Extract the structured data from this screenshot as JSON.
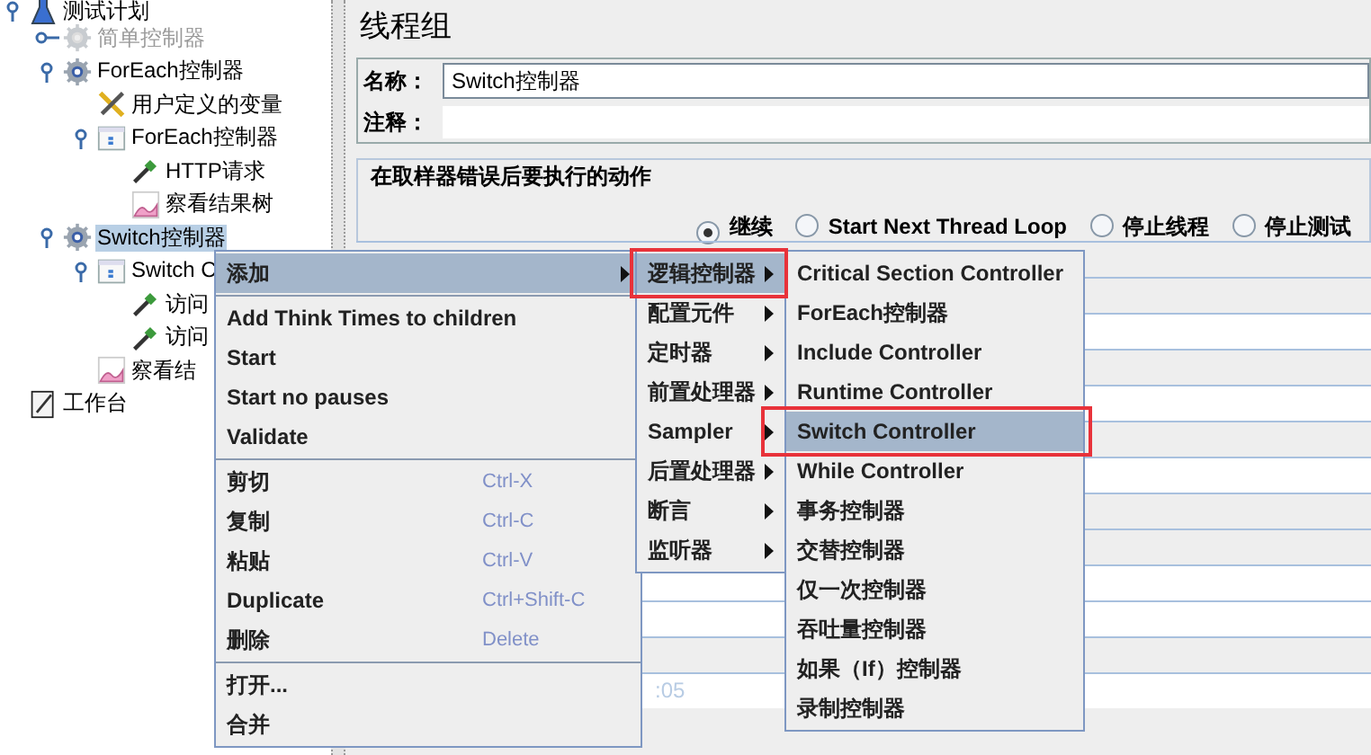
{
  "tree": [
    {
      "label": "测试计划",
      "kind": "flask",
      "selected": false,
      "disabled": false,
      "expanded": true,
      "children": [
        {
          "label": "简单控制器",
          "kind": "gear",
          "selected": false,
          "disabled": true,
          "expanded": false
        },
        {
          "label": "ForEach控制器",
          "kind": "gear",
          "selected": false,
          "disabled": false,
          "expanded": true,
          "children": [
            {
              "label": "用户定义的变量",
              "kind": "wrench",
              "selected": false,
              "disabled": false
            },
            {
              "label": "ForEach控制器",
              "kind": "panel",
              "selected": false,
              "disabled": false,
              "expanded": true,
              "children": [
                {
                  "label": "HTTP请求",
                  "kind": "pipette",
                  "selected": false,
                  "disabled": false
                },
                {
                  "label": "察看结果树",
                  "kind": "chart",
                  "selected": false,
                  "disabled": false
                }
              ]
            }
          ]
        },
        {
          "label": "Switch控制器",
          "kind": "gear",
          "selected": true,
          "disabled": false,
          "expanded": true,
          "children": [
            {
              "label": "Switch C",
              "kind": "panel",
              "selected": false,
              "disabled": false,
              "expanded": true,
              "children": [
                {
                  "label": "访问",
                  "kind": "pipette",
                  "selected": false,
                  "disabled": false
                },
                {
                  "label": "访问",
                  "kind": "pipette",
                  "selected": false,
                  "disabled": false
                }
              ]
            },
            {
              "label": "察看结",
              "kind": "chart",
              "selected": false,
              "disabled": false
            }
          ]
        }
      ]
    },
    {
      "label": "工作台",
      "kind": "notepad",
      "selected": false,
      "disabled": false
    }
  ],
  "panel": {
    "title": "线程组",
    "name_label": "名称：",
    "name_value": "Switch控制器",
    "comment_label": "注释：",
    "error_group": "在取样器错误后要执行的动作",
    "radios": [
      {
        "label": "继续",
        "selected": true
      },
      {
        "label": "Start Next Thread Loop",
        "selected": false
      },
      {
        "label": "停止线程",
        "selected": false
      },
      {
        "label": "停止测试",
        "selected": false
      }
    ],
    "field_value": ":05"
  },
  "context_menu": [
    {
      "kind": "item",
      "label": "添加",
      "submenu": true,
      "selected": true
    },
    {
      "kind": "separator"
    },
    {
      "kind": "item",
      "label": "Add Think Times to children",
      "submenu": false,
      "selected": false
    },
    {
      "kind": "item",
      "label": "Start",
      "submenu": false,
      "selected": false
    },
    {
      "kind": "item",
      "label": "Start no pauses",
      "submenu": false,
      "selected": false
    },
    {
      "kind": "item",
      "label": "Validate",
      "submenu": false,
      "selected": false
    },
    {
      "kind": "separator"
    },
    {
      "kind": "item",
      "label": "剪切",
      "shortcut": "Ctrl-X",
      "submenu": false,
      "selected": false
    },
    {
      "kind": "item",
      "label": "复制",
      "shortcut": "Ctrl-C",
      "submenu": false,
      "selected": false
    },
    {
      "kind": "item",
      "label": "粘贴",
      "shortcut": "Ctrl-V",
      "submenu": false,
      "selected": false
    },
    {
      "kind": "item",
      "label": "Duplicate",
      "shortcut": "Ctrl+Shift-C",
      "submenu": false,
      "selected": false
    },
    {
      "kind": "item",
      "label": "删除",
      "shortcut": "Delete",
      "submenu": false,
      "selected": false
    },
    {
      "kind": "separator"
    },
    {
      "kind": "item",
      "label": "打开...",
      "submenu": false,
      "selected": false
    },
    {
      "kind": "item",
      "label": "合并",
      "submenu": false,
      "selected": false
    }
  ],
  "add_submenu": [
    {
      "label": "逻辑控制器",
      "selected": true,
      "highlighted": true
    },
    {
      "label": "配置元件",
      "selected": false,
      "highlighted": false
    },
    {
      "label": "定时器",
      "selected": false,
      "highlighted": false
    },
    {
      "label": "前置处理器",
      "selected": false,
      "highlighted": false
    },
    {
      "label": "Sampler",
      "selected": false,
      "highlighted": false
    },
    {
      "label": "后置处理器",
      "selected": false,
      "highlighted": false
    },
    {
      "label": "断言",
      "selected": false,
      "highlighted": false
    },
    {
      "label": "监听器",
      "selected": false,
      "highlighted": false
    }
  ],
  "logic_controllers": [
    {
      "label": "Critical Section Controller",
      "selected": false,
      "highlighted": false
    },
    {
      "label": "ForEach控制器",
      "selected": false,
      "highlighted": false
    },
    {
      "label": "Include Controller",
      "selected": false,
      "highlighted": false
    },
    {
      "label": "Runtime Controller",
      "selected": false,
      "highlighted": false
    },
    {
      "label": "Switch Controller",
      "selected": true,
      "highlighted": true
    },
    {
      "label": "While Controller",
      "selected": false,
      "highlighted": false
    },
    {
      "label": "事务控制器",
      "selected": false,
      "highlighted": false
    },
    {
      "label": "交替控制器",
      "selected": false,
      "highlighted": false
    },
    {
      "label": "仅一次控制器",
      "selected": false,
      "highlighted": false
    },
    {
      "label": "吞吐量控制器",
      "selected": false,
      "highlighted": false
    },
    {
      "label": "如果（If）控制器",
      "selected": false,
      "highlighted": false
    },
    {
      "label": "录制控制器",
      "selected": false,
      "highlighted": false
    }
  ]
}
